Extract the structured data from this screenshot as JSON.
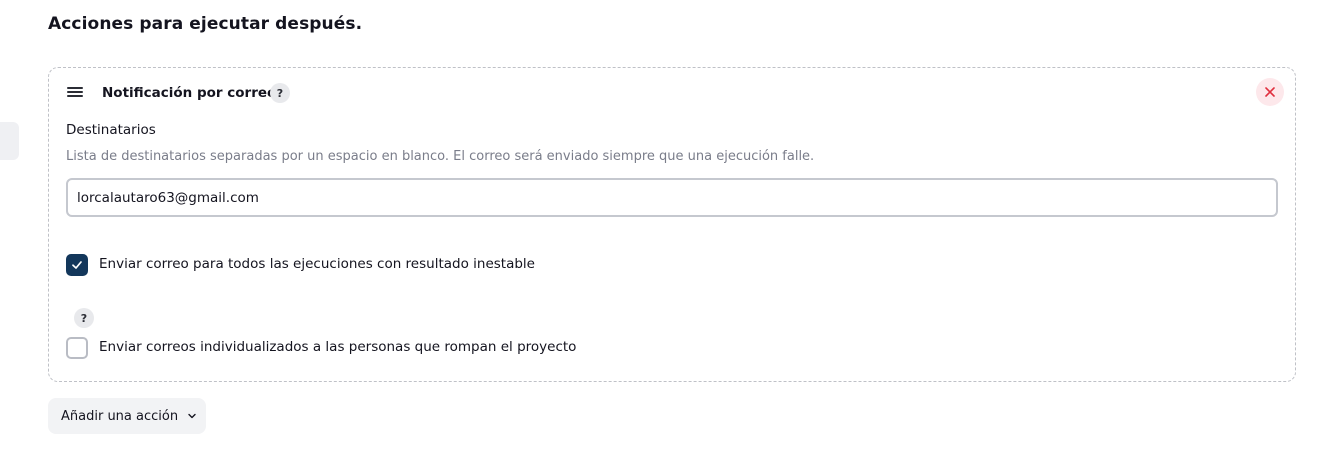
{
  "section": {
    "title": "Acciones para ejecutar después."
  },
  "card": {
    "title": "Notificación por correo",
    "help": "?",
    "icons": {
      "drag": "drag-handle-icon",
      "close": "close-icon"
    },
    "recipients": {
      "label": "Destinatarios",
      "description": "Lista de destinatarios separadas por un espacio en blanco. El correo será enviado siempre que una ejecución falle.",
      "value": "lorcalautaro63@gmail.com"
    },
    "options": [
      {
        "label": "Enviar correo para todos las ejecuciones con resultado inestable",
        "checked": true
      },
      {
        "label": "Enviar correos individualizados a las personas que rompan el proyecto",
        "checked": false,
        "help": "?"
      }
    ]
  },
  "add_action": {
    "label": "Añadir una acción",
    "icon": "chevron-down-icon"
  },
  "colors": {
    "checkbox_checked": "#13375b",
    "close_bg": "#fde8eb",
    "close_icon": "#e0303f"
  }
}
